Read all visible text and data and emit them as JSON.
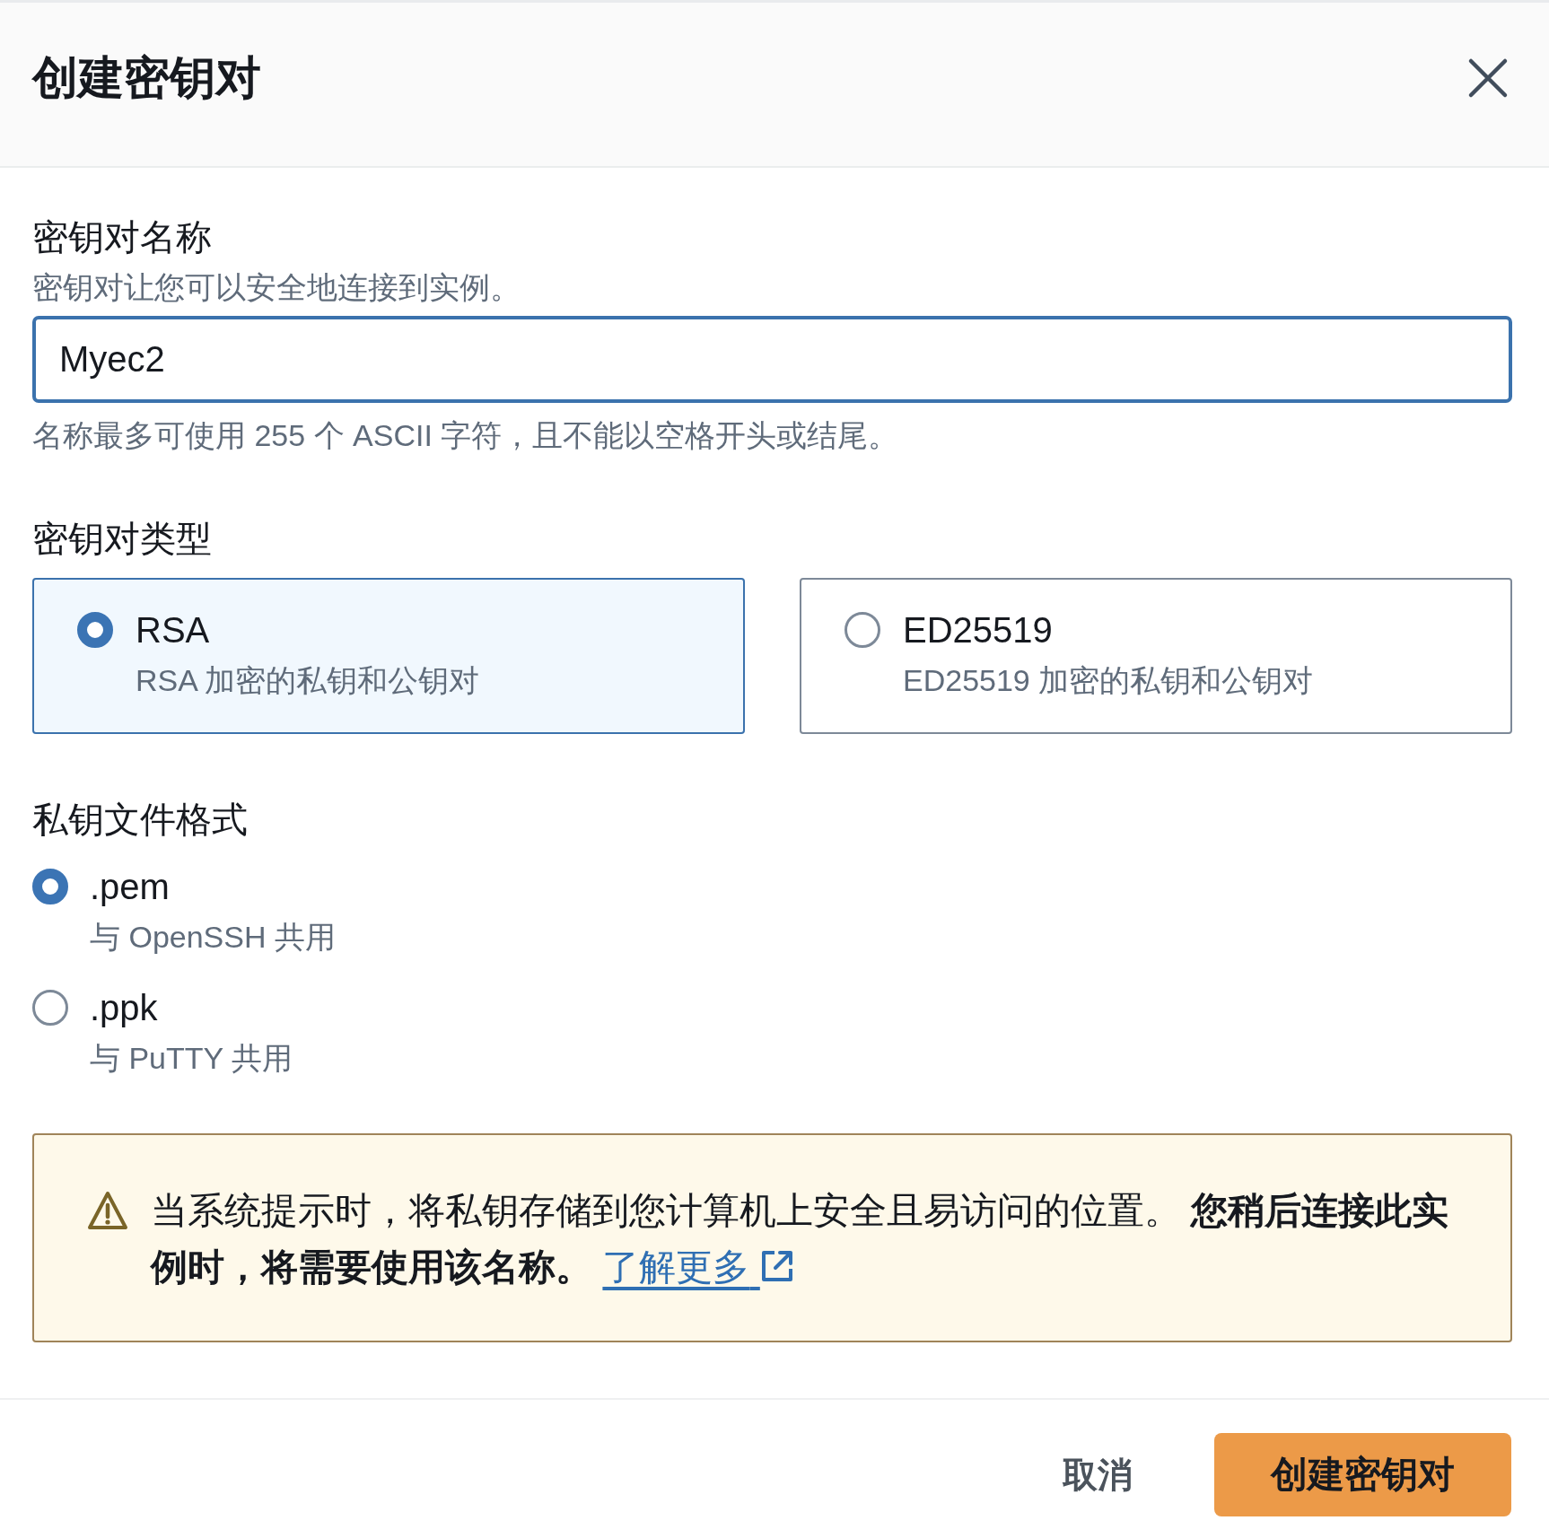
{
  "dialog": {
    "title": "创建密钥对"
  },
  "name_field": {
    "label": "密钥对名称",
    "description": "密钥对让您可以安全地连接到实例。",
    "value": "Myec2",
    "focused": true,
    "constraint": "名称最多可使用 255 个 ASCII 字符，且不能以空格开头或结尾。"
  },
  "key_type": {
    "label": "密钥对类型",
    "options": [
      {
        "label": "RSA",
        "description": "RSA 加密的私钥和公钥对",
        "selected": true
      },
      {
        "label": "ED25519",
        "description": "ED25519 加密的私钥和公钥对",
        "selected": false
      }
    ]
  },
  "file_format": {
    "label": "私钥文件格式",
    "options": [
      {
        "label": ".pem",
        "description": "与 OpenSSH 共用",
        "selected": true
      },
      {
        "label": ".ppk",
        "description": "与 PuTTY 共用",
        "selected": false
      }
    ]
  },
  "warning": {
    "message": "当系统提示时，将私钥存储到您计算机上安全且易访问的位置。 **您稍后连接此实例时，将需要使用该名称。**",
    "link": "了解更多"
  },
  "footer": {
    "buttons": [
      {
        "label": "取消",
        "kind": "link"
      },
      {
        "label": "创建密钥对",
        "kind": "primary"
      }
    ]
  }
}
